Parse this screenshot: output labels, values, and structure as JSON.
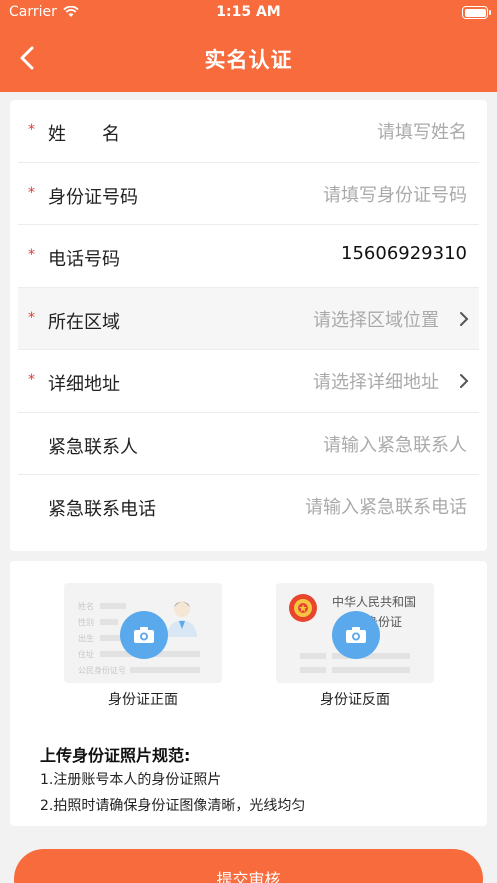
{
  "status_bar": {
    "carrier": "Carrier",
    "time": "1:15 AM"
  },
  "nav": {
    "title": "实名认证"
  },
  "form": {
    "rows": [
      {
        "required": true,
        "label": "姓　　名",
        "value": "请填写姓名",
        "filled": false,
        "arrow": false
      },
      {
        "required": true,
        "label": "身份证号码",
        "value": "请填写身份证号码",
        "filled": false,
        "arrow": false
      },
      {
        "required": true,
        "label": "电话号码",
        "value": "15606929310",
        "filled": true,
        "arrow": false
      },
      {
        "required": true,
        "label": "所在区域",
        "value": "请选择区域位置",
        "filled": false,
        "arrow": true
      },
      {
        "required": true,
        "label": "详细地址",
        "value": "请选择详细地址",
        "filled": false,
        "arrow": true
      },
      {
        "required": false,
        "label": "紧急联系人",
        "value": "请输入紧急联系人",
        "filled": false,
        "arrow": false
      },
      {
        "required": false,
        "label": "紧急联系电话",
        "value": "请输入紧急联系电话",
        "filled": false,
        "arrow": false
      }
    ],
    "required_mark": "*"
  },
  "upload": {
    "front_caption": "身份证正面",
    "back_caption": "身份证反面",
    "front_card_fields": [
      "姓名",
      "性别",
      "出生",
      "住址",
      "公民身份证号"
    ],
    "back_card_title_1": "中华人民共和国",
    "back_card_title_2": "居民身份证",
    "rules_title": "上传身份证照片规范:",
    "rules": [
      "1.注册账号本人的身份证照片",
      "2.拍照时请确保身份证图像清晰，光线均匀"
    ]
  },
  "submit_label": "提交审核",
  "colors": {
    "accent": "#f76b3c",
    "camera": "#5aa9ec",
    "required": "#e23b2c"
  }
}
